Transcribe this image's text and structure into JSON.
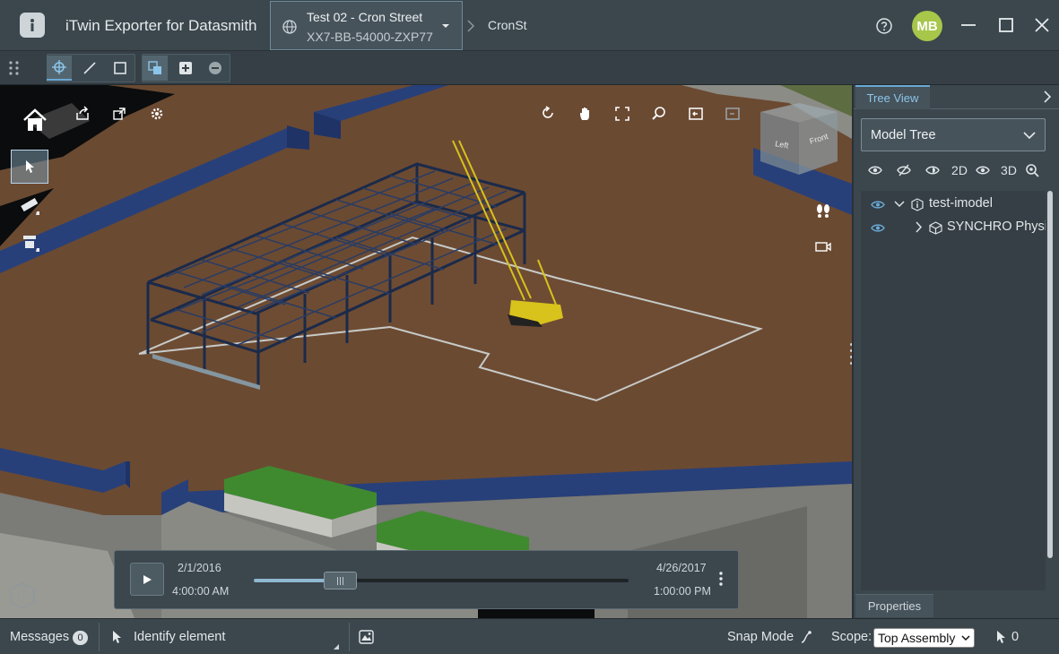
{
  "app": {
    "title": "iTwin Exporter for Datasmith"
  },
  "project": {
    "name": "Test 02 - Cron Street",
    "number": "XX7-BB-54000-ZXP77"
  },
  "breadcrumb": {
    "imodel": "CronSt"
  },
  "user": {
    "initials": "MB"
  },
  "view_cube": {
    "left_face": "Left",
    "front_face": "Front"
  },
  "timeline": {
    "start_date": "2/1/2016",
    "start_time": "4:00:00 AM",
    "end_date": "4/26/2017",
    "end_time": "1:00:00 PM",
    "progress": 0.23
  },
  "panel": {
    "tab_tree": "Tree View",
    "tab_properties": "Properties",
    "tree_type": "Model Tree",
    "vis_2d": "2D",
    "vis_3d": "3D",
    "tree_items": [
      {
        "label": "test-imodel"
      },
      {
        "label": "SYNCHRO Physical"
      }
    ]
  },
  "status": {
    "messages_label": "Messages",
    "messages_count": "0",
    "tool_prompt": "Identify element",
    "snap_mode": "Snap Mode",
    "scope_label": "Scope:",
    "scope_value": "Top Assembly",
    "selection_count": "0"
  },
  "colors": {
    "accent": "#6aa9d6",
    "avatar": "#a7c64a",
    "ground": "#6b4a32",
    "wall": "#27407a",
    "roof": "#3f8a2f"
  }
}
